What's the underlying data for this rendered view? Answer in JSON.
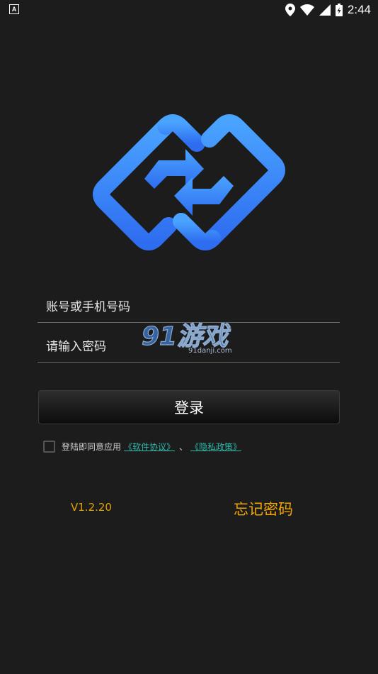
{
  "statusbar": {
    "time": "2:44",
    "notification_icon": "a-notification-icon"
  },
  "login": {
    "account_placeholder": "账号或手机号码",
    "password_placeholder": "请输入密码",
    "login_label": "登录",
    "agree_text": "登陆即同意应用",
    "terms_link": "《软件协议》",
    "separator": "、",
    "privacy_link": "《隐私政策》"
  },
  "footer": {
    "version": "V1.2.20",
    "forgot_label": "忘记密码"
  },
  "watermark": {
    "text": "91游戏",
    "subtext": "91danji.com"
  },
  "colors": {
    "background": "#1c1c1c",
    "logo_gradient_top": "#4aa3ff",
    "logo_gradient_bottom": "#2e6df0",
    "accent_orange": "#f0a500",
    "link_teal": "#2fb8a8"
  }
}
